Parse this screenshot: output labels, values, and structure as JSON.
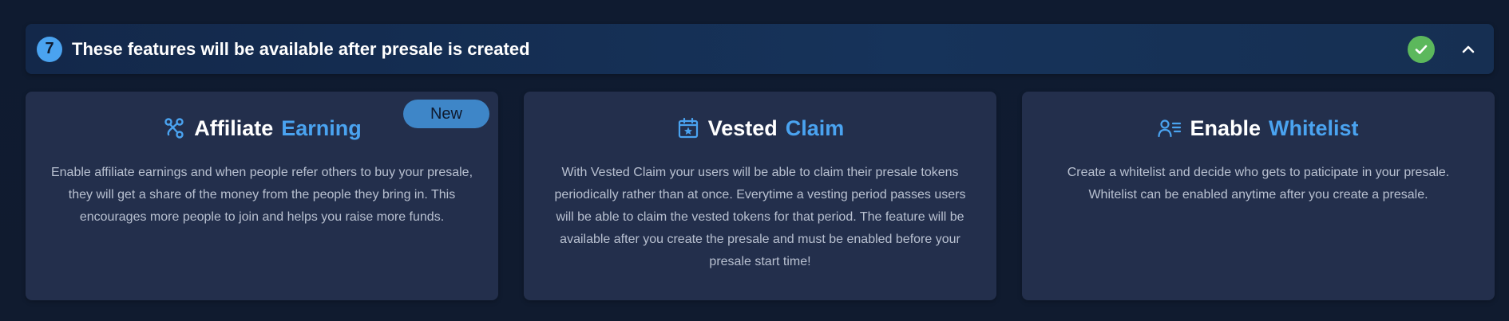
{
  "header": {
    "step_number": "7",
    "title": "These features will be available after presale is created"
  },
  "cards": [
    {
      "title_primary": "Affiliate",
      "title_accent": "Earning",
      "badge": "New",
      "icon": "affiliate-network-icon",
      "description": "Enable affiliate earnings and when people refer others to buy your presale, they will get a share of the money from the people they bring in. This encourages more people to join and helps you raise more funds."
    },
    {
      "title_primary": "Vested",
      "title_accent": "Claim",
      "icon": "calendar-star-icon",
      "description": "With Vested Claim your users will be able to claim their presale tokens periodically rather than at once. Everytime a vesting period passes users will be able to claim the vested tokens for that period. The feature will be available after you create the presale and must be enabled before your presale start time!"
    },
    {
      "title_primary": "Enable",
      "title_accent": "Whitelist",
      "icon": "user-list-icon",
      "description": "Create a whitelist and decide who gets to paticipate in your presale. Whitelist can be enabled anytime after you create a presale."
    }
  ],
  "colors": {
    "accent": "#4aa3f0",
    "success": "#5cb85c",
    "card_bg": "#232f4c",
    "page_bg": "#0f1a2e"
  }
}
